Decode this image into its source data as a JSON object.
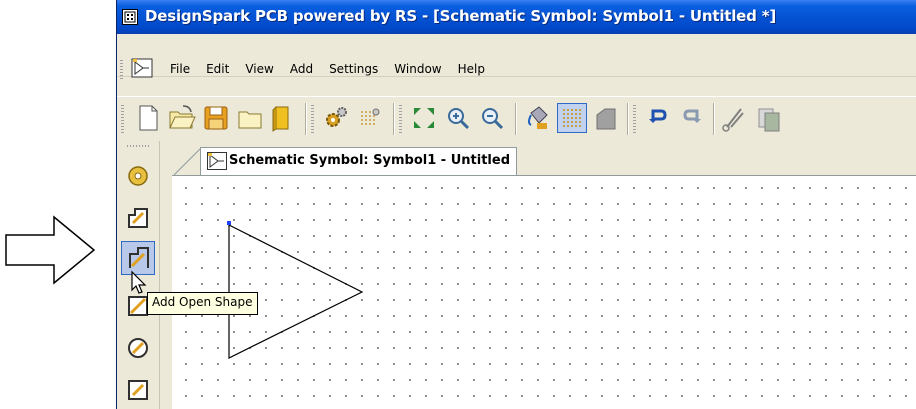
{
  "window": {
    "title": "DesignSpark PCB powered by RS - [Schematic Symbol: Symbol1 - Untitled *]"
  },
  "menu": {
    "items": [
      "File",
      "Edit",
      "View",
      "Add",
      "Settings",
      "Window",
      "Help"
    ]
  },
  "toolbar": {
    "buttons": [
      "new-document-icon",
      "open-folder-icon",
      "save-icon",
      "close-document-icon",
      "library-icon",
      "settings-gears-icon",
      "grid-settings-icon",
      "zoom-fit-icon",
      "zoom-in-icon",
      "zoom-out-icon",
      "fill-bucket-icon",
      "grid-toggle-icon",
      "layer-icon",
      "undo-icon",
      "redo-icon",
      "cut-icon",
      "copy-icon"
    ],
    "active": "grid-toggle-icon"
  },
  "left_toolbar": {
    "buttons": [
      "add-pin-icon",
      "add-closed-shape-icon",
      "add-open-shape-icon",
      "add-line-icon",
      "add-circle-icon",
      "add-rectangle-icon"
    ],
    "active": "add-open-shape-icon"
  },
  "tab": {
    "label": "Schematic Symbol: Symbol1 - Untitled"
  },
  "tooltip": {
    "text": "Add Open Shape"
  },
  "colors": {
    "titlebar": "#0553d5",
    "chrome": "#ece9d8",
    "active_button": "#c1d2ee",
    "tooltip_bg": "#ffffe1",
    "canvas_bg": "#ffffff"
  }
}
